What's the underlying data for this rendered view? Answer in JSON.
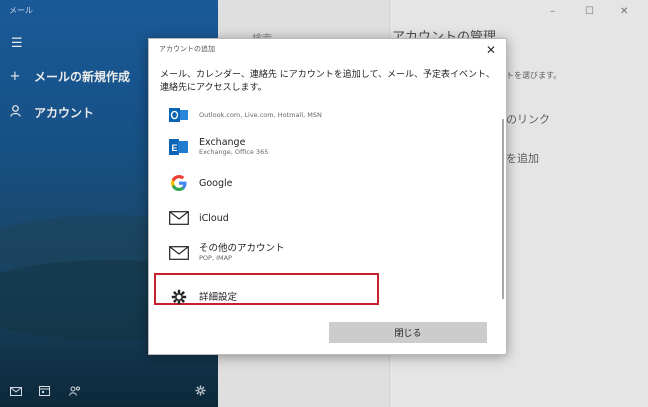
{
  "app": {
    "title": "メール"
  },
  "sidebar": {
    "menu_icon": "hamburger-icon",
    "new_mail": {
      "icon": "plus-icon",
      "label": "メールの新規作成"
    },
    "accounts": {
      "icon": "person-icon",
      "label": "アカウント"
    },
    "bottom_icons": [
      "mail-icon",
      "calendar-icon",
      "people-icon",
      "settings-icon"
    ]
  },
  "window_controls": {
    "minimize": "–",
    "maximize": "☐",
    "close": "✕"
  },
  "middle_pane": {
    "text": "検索"
  },
  "right_pane": {
    "title": "アカウントの管理",
    "line1": "トを選びます。",
    "line2": "のリンク",
    "line3": "を追加"
  },
  "dialog": {
    "title": "アカウントの追加",
    "close_glyph": "✕",
    "description": "メール、カレンダー、連絡先 にアカウントを追加して、メール、予定表イベント、連絡先にアクセスします。",
    "accounts": [
      {
        "name": "",
        "sub": "Outlook.com, Live.com, Hotmail, MSN",
        "icon": "outlook-icon"
      },
      {
        "name": "Exchange",
        "sub": "Exchange, Office 365",
        "icon": "exchange-icon"
      },
      {
        "name": "Google",
        "sub": "",
        "icon": "google-icon"
      },
      {
        "name": "iCloud",
        "sub": "",
        "icon": "envelope-icon"
      },
      {
        "name": "その他のアカウント",
        "sub": "POP, IMAP",
        "icon": "envelope-icon"
      },
      {
        "name": "詳細設定",
        "sub": "",
        "icon": "gear-icon"
      }
    ],
    "close_button": "閉じる",
    "highlight_color": "#c8202f"
  }
}
